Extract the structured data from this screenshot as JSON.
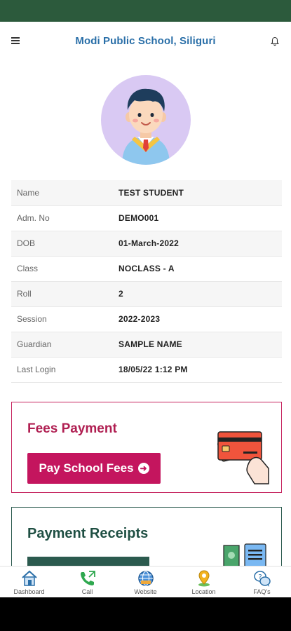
{
  "header": {
    "title": "Modi Public School, Siliguri"
  },
  "profile": {
    "rows": [
      {
        "label": "Name",
        "value": "TEST STUDENT"
      },
      {
        "label": "Adm. No",
        "value": "DEMO001"
      },
      {
        "label": "DOB",
        "value": "01-March-2022"
      },
      {
        "label": "Class",
        "value": "NOCLASS - A"
      },
      {
        "label": "Roll",
        "value": "2"
      },
      {
        "label": "Session",
        "value": "2022-2023"
      },
      {
        "label": "Guardian",
        "value": "SAMPLE NAME"
      },
      {
        "label": "Last Login",
        "value": "18/05/22 1:12 PM"
      }
    ]
  },
  "fees": {
    "title": "Fees Payment",
    "button_label": "Pay School Fees"
  },
  "receipts": {
    "title": "Payment Receipts"
  },
  "bottom_nav": [
    {
      "label": "Dashboard",
      "icon": "home-icon"
    },
    {
      "label": "Call",
      "icon": "phone-icon"
    },
    {
      "label": "Website",
      "icon": "globe-icon"
    },
    {
      "label": "Location",
      "icon": "location-pin-icon"
    },
    {
      "label": "FAQ's",
      "icon": "faq-chat-icon"
    }
  ],
  "colors": {
    "status_bar": "#2c5a3c",
    "header_title": "#2a6fa8",
    "fees_accent": "#c4155e",
    "receipts_accent": "#2b5a4e"
  }
}
